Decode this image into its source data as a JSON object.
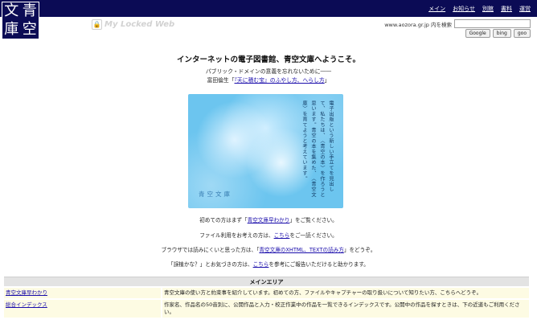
{
  "logo": {
    "chars": [
      "文",
      "青",
      "庫",
      "空"
    ]
  },
  "nav": [
    "メイン",
    "お知らせ",
    "別館",
    "書料",
    "運営"
  ],
  "watermark": {
    "text": "My Locked Web"
  },
  "search": {
    "label": "www.aozora.gr.jp 内を検索",
    "value": "",
    "buttons": [
      "Google",
      "bing",
      "goo"
    ]
  },
  "welcome": "インターネットの電子図書館、青空文庫へようこそ。",
  "subtitle": {
    "line1": "パブリック・ドメインの意義を忘れないために――",
    "line2_prefix": "富田倫生「",
    "line2_link": "『天に積む宝』のふやし方、へらし方",
    "line2_suffix": "」"
  },
  "banner": {
    "text": "電子出版という新しい手立てを見出して、私たちは、〈青空の本〉を作ろうと思います。青空の本を集めた、〈青空文庫〉を育てようと考えています。",
    "signature": "青空文庫"
  },
  "info": [
    {
      "prefix": "初めての方はまず「",
      "link": "青空文庫早わかり",
      "suffix": "」をご覧ください。"
    },
    {
      "prefix": "ファイル利用をお考えの方は、",
      "link": "こちら",
      "suffix": "をご一読ください。"
    },
    {
      "prefix": "ブラウザでは読みにくいと思った方は、「",
      "link": "青空文庫のXHTML、TEXTの読み方",
      "suffix": "」をどうぞ。"
    },
    {
      "prefix": "「誤植かな？」とお気づきの方は、",
      "link": "こちら",
      "suffix": "を参考にご報告いただけると助かります。"
    }
  ],
  "main_area": {
    "header": "メインエリア",
    "rows": [
      {
        "name": "青空文庫早わかり",
        "desc": "青空文庫の使い方と約束事を紹介しています。初めての方、ファイルやキャプチャーの取り扱いについて知りたい方、こちらへどうぞ。"
      },
      {
        "name": "総合インデックス",
        "desc": "作家名、作品名の50音別に、公開作品と入力・校正作業中の作品を一覧できるインデックスです。公開中の作品を探すときは、下の近道もご利用ください。"
      }
    ]
  }
}
